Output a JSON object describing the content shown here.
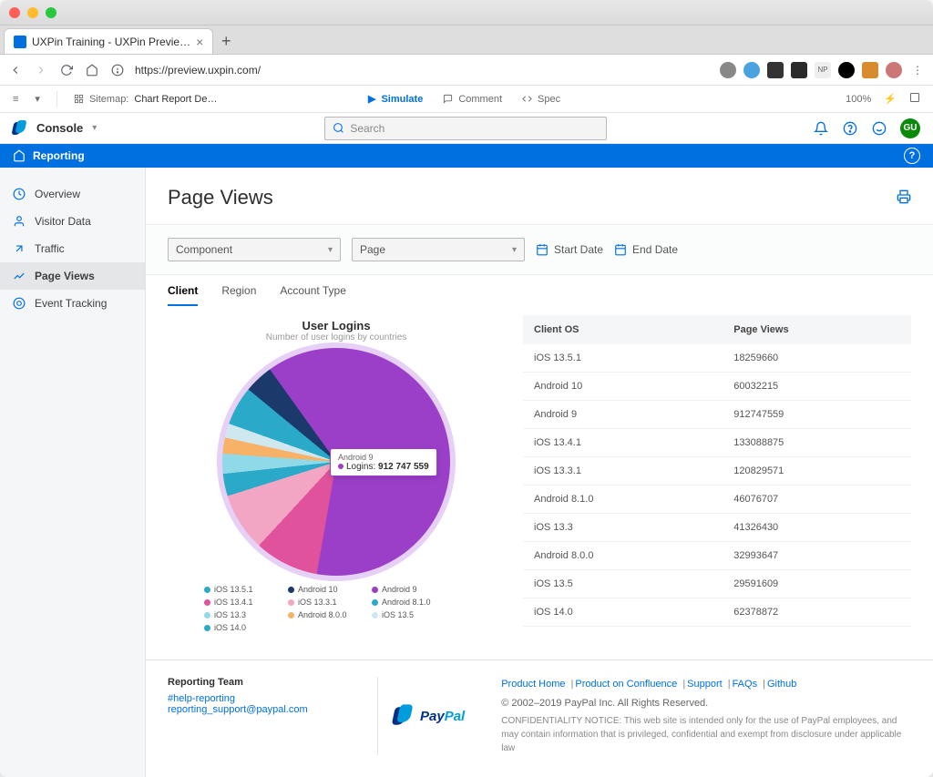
{
  "browser": {
    "tab_title": "UXPin Training - UXPin Previe…",
    "url": "https://preview.uxpin.com/",
    "ext_label_np": "NP"
  },
  "uxbar": {
    "menu": "≡",
    "sitemap_label": "Sitemap:",
    "sitemap_value": "Chart Report De…",
    "simulate": "Simulate",
    "comment": "Comment",
    "spec": "Spec",
    "zoom": "100%"
  },
  "header": {
    "app": "Console",
    "search_placeholder": "Search",
    "avatar": "GU"
  },
  "bluebar": {
    "title": "Reporting"
  },
  "sidebar": {
    "items": [
      {
        "label": "Overview",
        "icon": "gauge-icon"
      },
      {
        "label": "Visitor Data",
        "icon": "user-icon"
      },
      {
        "label": "Traffic",
        "icon": "arrows-icon"
      },
      {
        "label": "Page Views",
        "icon": "chart-icon"
      },
      {
        "label": "Event Tracking",
        "icon": "target-icon"
      }
    ],
    "active_index": 3
  },
  "page": {
    "title": "Page Views",
    "filters": {
      "component": "Component",
      "page": "Page",
      "start": "Start Date",
      "end": "End Date"
    },
    "tabs": [
      "Client",
      "Region",
      "Account Type"
    ],
    "active_tab": 0
  },
  "chart_data": {
    "type": "pie",
    "title": "User Logins",
    "subtitle": "Number of user logins by countries",
    "tooltip": {
      "category": "Android 9",
      "series": "Logins",
      "value": "912 747 559"
    },
    "series": [
      {
        "name": "iOS 13.5.1",
        "value": 18259660,
        "color": "#2aa9c9"
      },
      {
        "name": "Android 10",
        "value": 60032215,
        "color": "#1b3a6b"
      },
      {
        "name": "Android 9",
        "value": 912747559,
        "color": "#9b3fc9"
      },
      {
        "name": "iOS 13.4.1",
        "value": 133088875,
        "color": "#e0529c"
      },
      {
        "name": "iOS 13.3.1",
        "value": 120829571,
        "color": "#f2a6c4"
      },
      {
        "name": "Android 8.1.0",
        "value": 46076707,
        "color": "#2aa9c9"
      },
      {
        "name": "iOS 13.3",
        "value": 41326430,
        "color": "#8fd9e8"
      },
      {
        "name": "Android 8.0.0",
        "value": 32993647,
        "color": "#f7b267"
      },
      {
        "name": "iOS 13.5",
        "value": 29591609,
        "color": "#cfe8ef"
      },
      {
        "name": "iOS 14.0",
        "value": 62378872,
        "color": "#2aa9c9"
      }
    ]
  },
  "table": {
    "columns": [
      "Client OS",
      "Page Views"
    ],
    "rows": [
      [
        "iOS 13.5.1",
        "18259660"
      ],
      [
        "Android 10",
        "60032215"
      ],
      [
        "Android 9",
        "912747559"
      ],
      [
        "iOS 13.4.1",
        "133088875"
      ],
      [
        "iOS 13.3.1",
        "120829571"
      ],
      [
        "Android 8.1.0",
        "46076707"
      ],
      [
        "iOS 13.3",
        "41326430"
      ],
      [
        "Android 8.0.0",
        "32993647"
      ],
      [
        "iOS 13.5",
        "29591609"
      ],
      [
        "iOS 14.0",
        "62378872"
      ]
    ]
  },
  "footer": {
    "team": "Reporting Team",
    "channel": "#help-reporting",
    "email": "reporting_support@paypal.com",
    "brand": "PayPal",
    "links": [
      "Product Home",
      "Product on Confluence",
      "Support",
      "FAQs",
      "Github"
    ],
    "copyright": "© 2002–2019 PayPal Inc. All Rights Reserved.",
    "confidential": "CONFIDENTIALITY NOTICE: This web site is intended only for the use of PayPal employees, and may contain information that is privileged, confidential and exempt from disclosure under applicable law"
  }
}
